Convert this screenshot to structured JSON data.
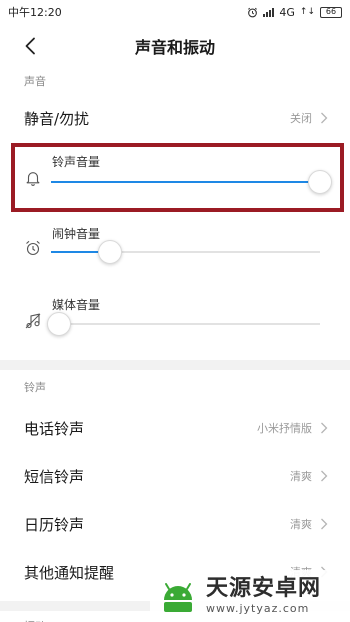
{
  "status_bar": {
    "time": "中午12:20",
    "network": "4G",
    "battery": "66"
  },
  "header": {
    "title": "声音和振动"
  },
  "sections": {
    "sound_label": "声音",
    "ringtone_label": "铃声",
    "vibration_label": "振动"
  },
  "silent_row": {
    "label": "静音/勿扰",
    "value": "关闭"
  },
  "volumes": {
    "ringtone": {
      "label": "铃声音量",
      "level_percent": 100
    },
    "alarm": {
      "label": "闹钟音量",
      "level_percent": 22
    },
    "media": {
      "label": "媒体音量",
      "level_percent": 3
    }
  },
  "ringtones": [
    {
      "label": "电话铃声",
      "value": "小米抒情版"
    },
    {
      "label": "短信铃声",
      "value": "清爽"
    },
    {
      "label": "日历铃声",
      "value": "清爽"
    },
    {
      "label": "其他通知提醒",
      "value": "清爽"
    }
  ],
  "colors": {
    "accent": "#1e88e5",
    "highlight_border": "#9b1b24",
    "logo_green": "#3aaa35"
  },
  "watermark": {
    "name": "天源安卓网",
    "url": "www.jytyaz.com"
  }
}
